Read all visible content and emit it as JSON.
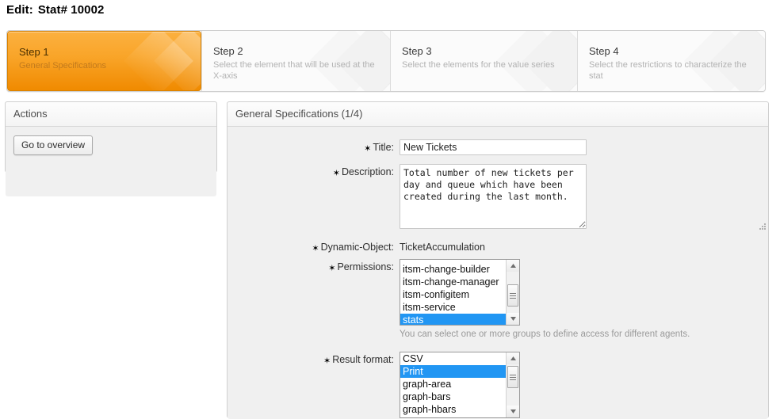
{
  "page": {
    "title_label": "Edit:",
    "title_value": "Stat# 10002"
  },
  "wizard": {
    "steps": [
      {
        "num": "Step 1",
        "desc": "General Specifications",
        "active": true
      },
      {
        "num": "Step 2",
        "desc": "Select the element that will be used at the X-axis",
        "active": false
      },
      {
        "num": "Step 3",
        "desc": "Select the elements for the value series",
        "active": false
      },
      {
        "num": "Step 4",
        "desc": "Select the restrictions to characterize the stat",
        "active": false
      }
    ]
  },
  "sidebar": {
    "header": "Actions",
    "go_to_overview_label": "Go to overview"
  },
  "main": {
    "header": "General Specifications (1/4)",
    "fields": {
      "title": {
        "label": "Title:",
        "required_marker": "✶",
        "value": "New Tickets"
      },
      "description": {
        "label": "Description:",
        "required_marker": "✶",
        "value": "Total number of new tickets per day and queue which have been created during the last month."
      },
      "dynamic_object": {
        "label": "Dynamic-Object:",
        "required_marker": "✶",
        "value": "TicketAccumulation"
      },
      "permissions": {
        "label": "Permissions:",
        "required_marker": "✶",
        "options": [
          "itsm-change-builder",
          "itsm-change-manager",
          "itsm-configitem",
          "itsm-service",
          "stats"
        ],
        "selected": "stats",
        "hint": "You can select one or more groups to define access for different agents."
      },
      "result_format": {
        "label": "Result format:",
        "required_marker": "✶",
        "options": [
          "CSV",
          "Print",
          "graph-area",
          "graph-bars",
          "graph-hbars"
        ],
        "selected": "Print"
      }
    }
  },
  "colors": {
    "accent_orange": "#f9a529",
    "selection_blue": "#2196f3",
    "page_bg": "#ffffff",
    "panel_bg": "#f0f0f0"
  }
}
